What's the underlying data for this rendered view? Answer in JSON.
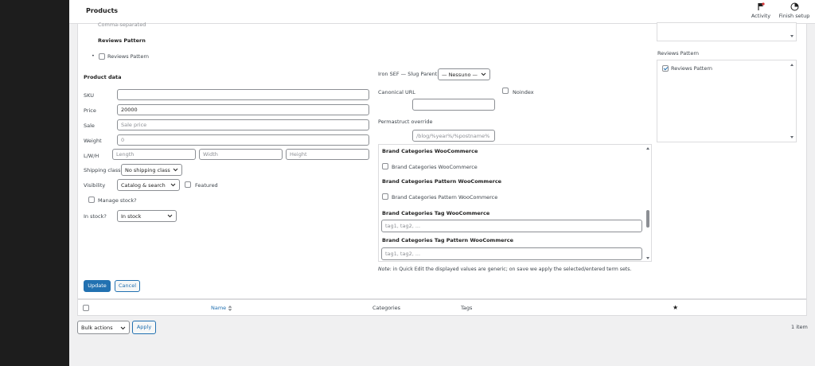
{
  "header": {
    "title": "Products",
    "activity_label": "Activity",
    "finish_setup_label": "Finish setup"
  },
  "left": {
    "comma_separated": "Comma-separated",
    "reviews_pattern_heading": "Reviews Pattern",
    "reviews_pattern_checkbox": "Reviews Pattern",
    "product_data_heading": "Product data",
    "sku_label": "SKU",
    "sku_value": "",
    "price_label": "Price",
    "price_value": "20000",
    "sale_label": "Sale",
    "sale_placeholder": "Sale price",
    "weight_label": "Weight",
    "weight_placeholder": "0",
    "lwh_label": "L/W/H",
    "length_placeholder": "Length",
    "width_placeholder": "Width",
    "height_placeholder": "Height",
    "shipping_class_label": "Shipping class",
    "shipping_class_value": "No shipping class",
    "visibility_label": "Visibility",
    "visibility_value": "Catalog & search",
    "featured_label": "Featured",
    "manage_stock_label": "Manage stock?",
    "in_stock_label": "In stock?",
    "in_stock_value": "In stock"
  },
  "middle": {
    "slug_parent_label": "Iron SEF — Slug Parent",
    "slug_parent_value": "— Nessuno —",
    "canonical_label": "Canonical URL",
    "canonical_value": "",
    "noindex_label": "Noindex",
    "permastruct_label": "Permastruct override",
    "permastruct_placeholder": "/blog/%year%/%postname%",
    "taxonomies": {
      "brand_cat_heading": "Brand Categories WooCommerce",
      "brand_cat_checkbox": "Brand Categories WooCommerce",
      "brand_cat_pattern_heading": "Brand Categories Pattern WooCommerce",
      "brand_cat_pattern_checkbox": "Brand Categories Pattern WooCommerce",
      "brand_tag_heading": "Brand Categories Tag WooCommerce",
      "brand_tag_placeholder": "tag1, tag2, ...",
      "brand_tag_pattern_heading": "Brand Categories Tag Pattern WooCommerce",
      "brand_tag_pattern_placeholder": "tag1, tag2, ..."
    },
    "note_prefix": "Note:",
    "note_text": " in Quick Edit the displayed values are generic; on save we apply the selected/entered term sets."
  },
  "right": {
    "reviews_pattern_heading": "Reviews Pattern",
    "reviews_pattern_checkbox": "Reviews Pattern"
  },
  "actions": {
    "update_label": "Update",
    "cancel_label": "Cancel"
  },
  "table": {
    "col_name": "Name",
    "col_categories": "Categories",
    "col_tags": "Tags",
    "featured_star": "★"
  },
  "footer": {
    "bulk_actions_value": "Bulk actions",
    "apply_label": "Apply",
    "item_count": "1 item"
  },
  "colors": {
    "primary": "#2271b1",
    "sidebar": "#1d1d1d",
    "background": "#f0f0f1"
  }
}
